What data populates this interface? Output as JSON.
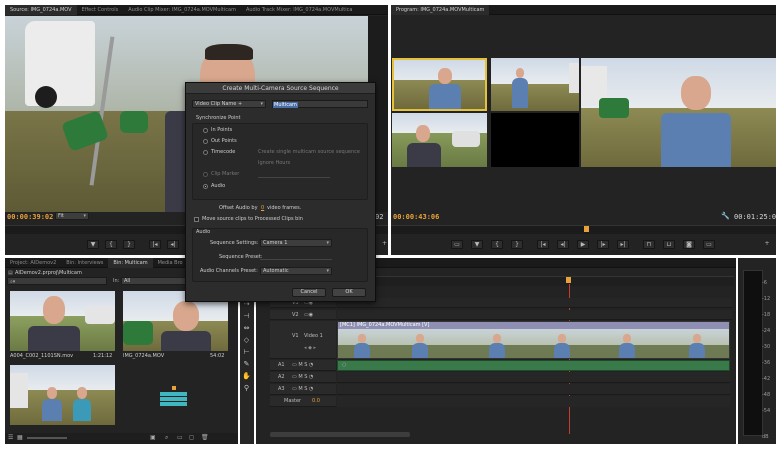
{
  "source_monitor": {
    "tabs": [
      "Source: IMG_0724a.MOV",
      "Effect Controls",
      "Audio Clip Mixer: IMG_0724a.MOVMulticam",
      "Audio Track Mixer: IMG_0724a.MOVMultica"
    ],
    "timecode_in": "00:00:39:02",
    "fit": "Fit",
    "timecode_out": "02"
  },
  "program_monitor": {
    "tab": "Program: IMG_0724a.MOVMulticam",
    "timecode_in": "00:00:43:06",
    "timecode_out": "00:01:25:00"
  },
  "dialog": {
    "title": "Create Multi-Camera Source Sequence",
    "name_select": "Video Clip Name +",
    "name_value": "Multicam",
    "sync_heading": "Synchronize Point",
    "sync_options": [
      "In Points",
      "Out Points",
      "Timecode",
      "Clip Marker",
      "Audio"
    ],
    "timecode_option": "Create single multicam source sequence",
    "ignore_hours": "Ignore Hours",
    "offset_audio_prefix": "Offset Audio by",
    "offset_audio_value": "0",
    "offset_audio_suffix": "video frames.",
    "move_clips": "Move source clips to Processed Clips bin",
    "audio_heading": "Audio",
    "sequence_settings_label": "Sequence Settings:",
    "sequence_settings_value": "Camera 1",
    "sequence_preset_label": "Sequence Preset:",
    "channels_preset_label": "Audio Channels Preset:",
    "channels_preset_value": "Automatic",
    "cancel": "Cancel",
    "ok": "OK"
  },
  "project_panel": {
    "tabs": [
      "Project: AIDemov2",
      "Bin: Interviews",
      "Bin: Multicam",
      "Media Bro"
    ],
    "path": "AIDemov2.prproj\\Multicam",
    "in_label": "In:",
    "in_value": "All",
    "items": [
      {
        "name": "A004_C002_1101SN.mov",
        "duration": "1:21:12"
      },
      {
        "name": "IMG_0724a.MOV",
        "duration": "54:02"
      },
      {
        "name": "",
        "duration": ""
      },
      {
        "name": "",
        "duration": ""
      }
    ]
  },
  "timeline": {
    "clip_label": "[MC1] IMG_0724a.MOVMulticam [V]",
    "tracks": [
      {
        "name": "V3"
      },
      {
        "name": "V2"
      },
      {
        "name": "Video 1",
        "id": "V1"
      },
      {
        "name": "A1"
      },
      {
        "name": "A2"
      },
      {
        "name": "A3"
      },
      {
        "name": "Master",
        "value": "0.0"
      }
    ]
  },
  "meters": {
    "labels": [
      "-6",
      "-12",
      "-18",
      "-24",
      "-30",
      "-36",
      "-42",
      "-48",
      "-54"
    ],
    "bottom": "dB"
  },
  "colors": {
    "accent": "#e8a23a",
    "panel": "#232323",
    "audio_track": "#3a7a4a",
    "playhead": "#c83c2c"
  }
}
